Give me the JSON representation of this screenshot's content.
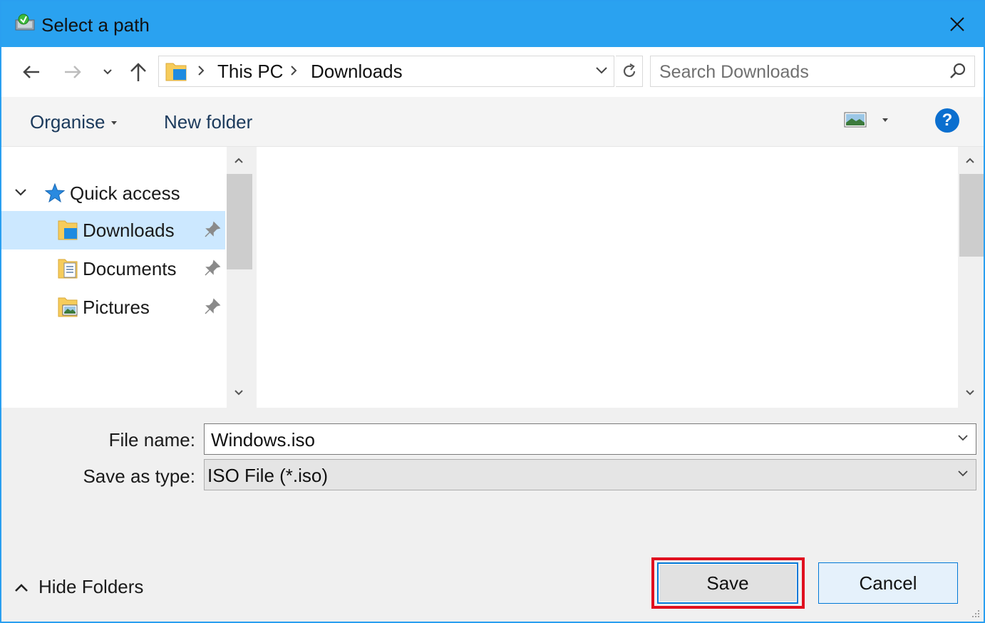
{
  "window": {
    "title": "Select a path"
  },
  "nav": {
    "breadcrumb": [
      "This PC",
      "Downloads"
    ],
    "search_placeholder": "Search Downloads"
  },
  "commands": {
    "organise": "Organise",
    "new_folder": "New folder",
    "help": "?"
  },
  "tree": {
    "quick_access": "Quick access",
    "items": [
      {
        "label": "Downloads",
        "icon": "downloads-folder-icon",
        "selected": true,
        "pinned": true
      },
      {
        "label": "Documents",
        "icon": "documents-folder-icon",
        "selected": false,
        "pinned": true
      },
      {
        "label": "Pictures",
        "icon": "pictures-folder-icon",
        "selected": false,
        "pinned": true
      }
    ]
  },
  "form": {
    "file_name_label": "File name:",
    "file_name_value": "Windows.iso",
    "save_type_label": "Save as type:",
    "save_type_value": "ISO File (*.iso)"
  },
  "footer": {
    "hide_folders": "Hide Folders",
    "save": "Save",
    "cancel": "Cancel"
  },
  "colors": {
    "titlebar": "#2aa2f0",
    "selection": "#cce8ff",
    "accent": "#0078d7",
    "highlight_box": "#e0101f"
  }
}
